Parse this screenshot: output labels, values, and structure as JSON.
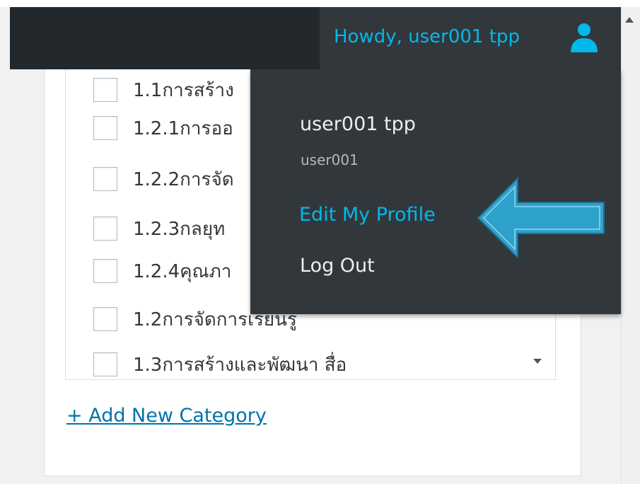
{
  "admin_bar": {
    "greeting": "Howdy, user001 tpp",
    "user_icon": "user-avatar-icon"
  },
  "account_menu": {
    "display_name": "user001 tpp",
    "username": "user001",
    "edit_profile": "Edit My Profile",
    "log_out": "Log Out"
  },
  "categories": {
    "items": [
      {
        "label": "1.1การสร้าง"
      },
      {
        "label": "1.2.1การออ"
      },
      {
        "label": "1.2.2การจัด"
      },
      {
        "label": "1.2.3กลยุท"
      },
      {
        "label": "1.2.4คุณภา"
      },
      {
        "label": "1.2การจัดการเรียนรู"
      },
      {
        "label": "1.3การสร้างและพัฒนา สื่อ"
      }
    ],
    "add_new": "+ Add New Category"
  },
  "annotation": {
    "arrow_icon": "callout-arrow-icon",
    "arrow_color": "#2ea2cc"
  },
  "colors": {
    "admin_bar": "#23282d",
    "submenu": "#32373c",
    "highlight": "#00b9eb",
    "link": "#0073aa"
  }
}
